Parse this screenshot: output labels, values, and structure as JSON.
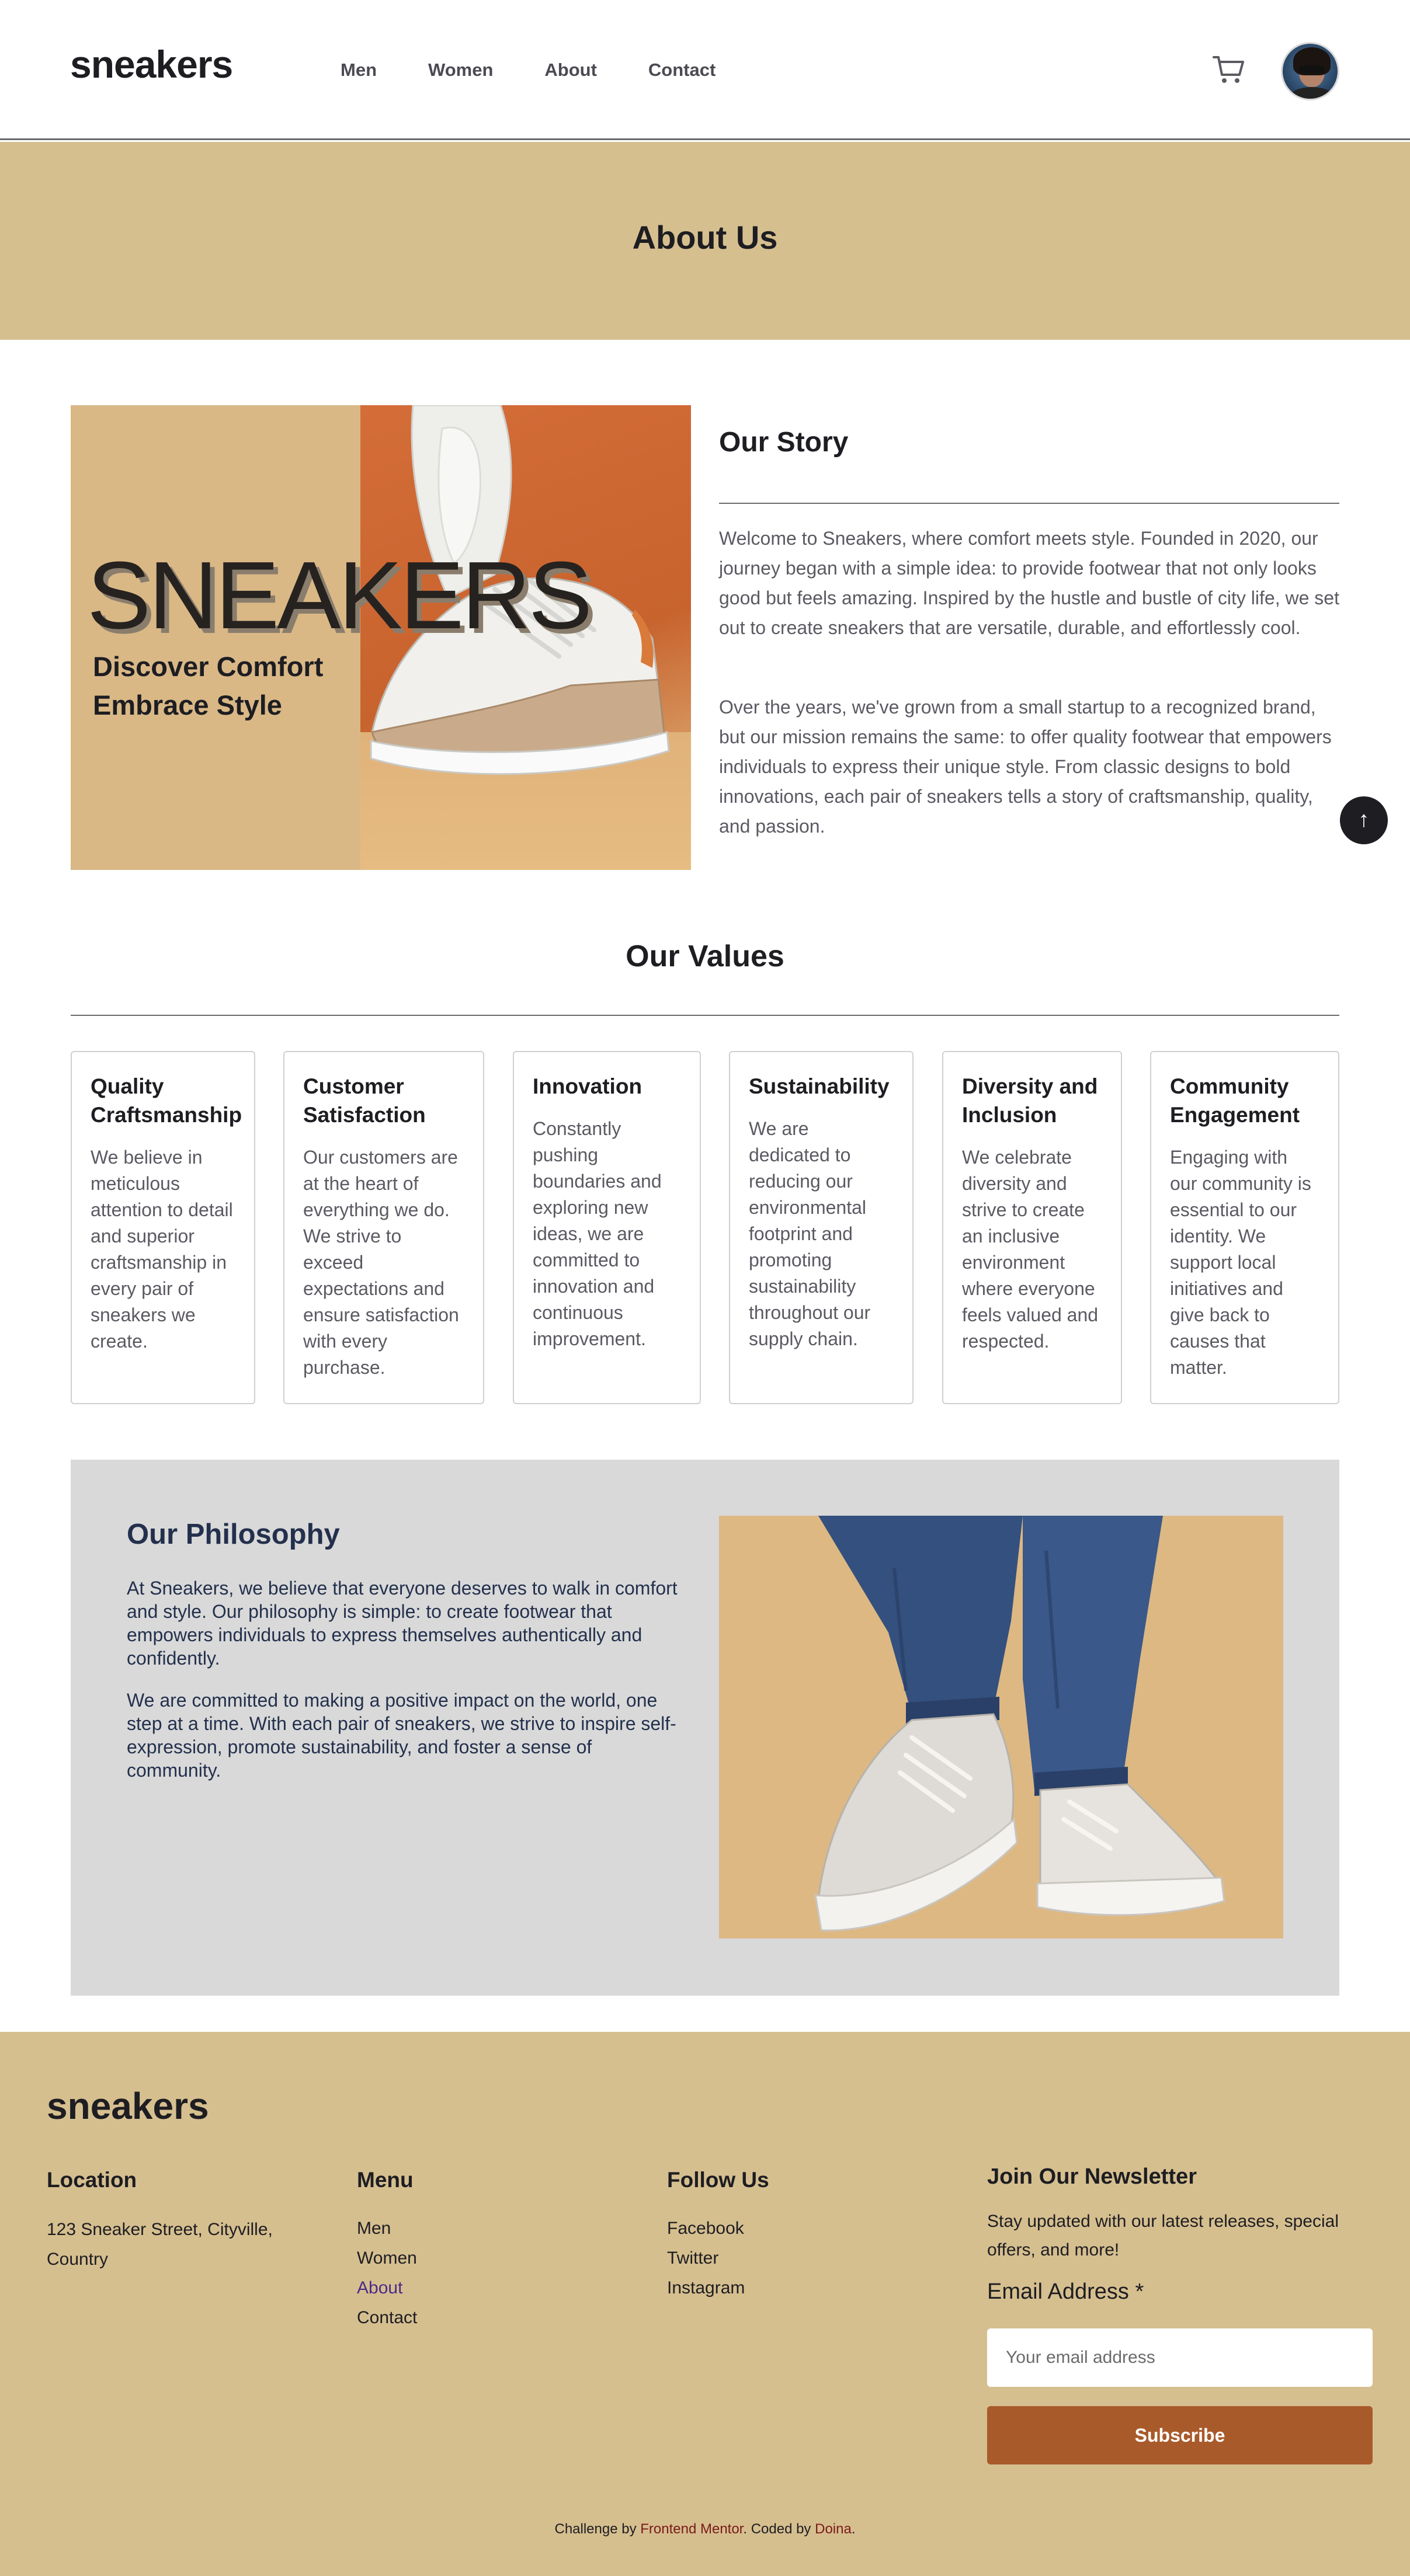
{
  "header": {
    "logo": "sneakers",
    "nav": [
      "Men",
      "Women",
      "About",
      "Contact"
    ],
    "cart_icon": "cart-icon",
    "avatar_icon": "avatar"
  },
  "hero": {
    "title": "About Us"
  },
  "story": {
    "image": {
      "word": "SNEAKERS",
      "tagline_1": "Discover Comfort",
      "tagline_2": "Embrace Style"
    },
    "title": "Our Story",
    "paragraphs": [
      "Welcome to Sneakers, where comfort meets style. Founded in 2020, our journey began with a simple idea: to provide footwear that not only looks good but feels amazing. Inspired by the hustle and bustle of city life, we set out to create sneakers that are versatile, durable, and effortlessly cool.",
      "Over the years, we've grown from a small startup to a recognized brand, but our mission remains the same: to offer quality footwear that empowers individuals to express their unique style. From classic designs to bold innovations, each pair of sneakers tells a story of craftsmanship, quality, and passion."
    ],
    "scroll_top": "↑"
  },
  "values": {
    "title": "Our Values",
    "cards": [
      {
        "title": "Quality Craftsmanship",
        "text": "We believe in meticulous attention to detail and superior craftsmanship in every pair of sneakers we create."
      },
      {
        "title": "Customer Satisfaction",
        "text": "Our customers are at the heart of everything we do. We strive to exceed expectations and ensure satisfaction with every purchase."
      },
      {
        "title": "Innovation",
        "text": "Constantly pushing boundaries and exploring new ideas, we are committed to innovation and continuous improvement."
      },
      {
        "title": "Sustainability",
        "text": "We are dedicated to reducing our environmental footprint and promoting sustainability throughout our supply chain."
      },
      {
        "title": "Diversity and Inclusion",
        "text": "We celebrate diversity and strive to create an inclusive environment where everyone feels valued and respected."
      },
      {
        "title": "Community Engagement",
        "text": "Engaging with our community is essential to our identity. We support local initiatives and give back to causes that matter."
      }
    ]
  },
  "philosophy": {
    "title": "Our Philosophy",
    "paragraphs": [
      "At Sneakers, we believe that everyone deserves to walk in comfort and style. Our philosophy is simple: to create footwear that empowers individuals to express themselves authentically and confidently.",
      "We are committed to making a positive impact on the world, one step at a time. With each pair of sneakers, we strive to inspire self-expression, promote sustainability, and foster a sense of community."
    ]
  },
  "footer": {
    "logo": "sneakers",
    "location": {
      "heading": "Location",
      "address": "123 Sneaker Street, Cityville, Country"
    },
    "menu": {
      "heading": "Menu",
      "links": [
        "Men",
        "Women",
        "About",
        "Contact"
      ],
      "active": "About"
    },
    "follow": {
      "heading": "Follow Us",
      "links": [
        "Facebook",
        "Twitter",
        "Instagram"
      ]
    },
    "newsletter": {
      "heading": "Join Our Newsletter",
      "text": "Stay updated with our latest releases, special offers, and more!",
      "label": "Email Address *",
      "placeholder": "Your email address",
      "button": "Subscribe"
    },
    "credit": {
      "prefix": "Challenge by ",
      "challenge_link": "Frontend Mentor",
      "middle": ". Coded by ",
      "author_link": "Doina",
      "suffix": "."
    }
  },
  "colors": {
    "band": "#d6bf8f",
    "button": "#a95a2a",
    "philosophy_bg": "#d9d9d9",
    "heading_navy": "#23304d"
  }
}
